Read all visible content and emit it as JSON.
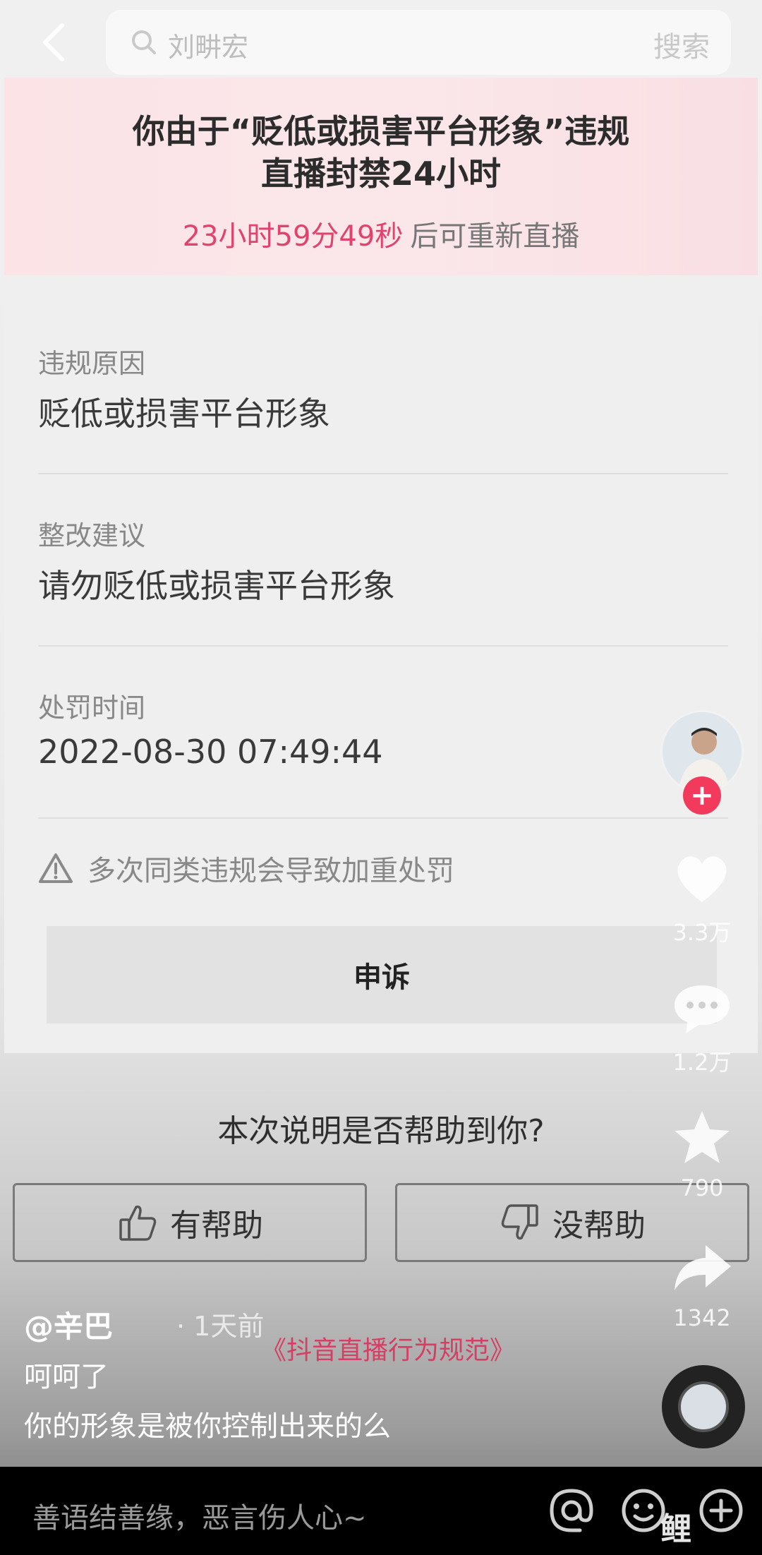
{
  "search": {
    "query": "刘畊宏",
    "button_label": "搜索"
  },
  "banner": {
    "line1": "你由于“贬低或损害平台形象”违规",
    "line2": "直播封禁24小时",
    "countdown": "23小时59分49秒",
    "countdown_suffix": "后可重新直播"
  },
  "details": {
    "reason_label": "违规原因",
    "reason_value": "贬低或损害平台形象",
    "advice_label": "整改建议",
    "advice_value": "请勿贬低或损害平台形象",
    "time_label": "处罚时间",
    "time_value": "2022-08-30 07:49:44",
    "warning": "多次同类违规会导致加重处罚",
    "appeal_label": "申诉"
  },
  "feedback": {
    "question": "本次说明是否帮助到你?",
    "helpful_label": "有帮助",
    "unhelpful_label": "没帮助"
  },
  "side": {
    "likes": "3.3万",
    "comments": "1.2万",
    "favorites": "790",
    "shares": "1342"
  },
  "caption": {
    "author": "@辛巴",
    "time_ago": "· 1天前",
    "rule_link": "《抖音直播行为规范》",
    "line1": "呵呵了",
    "line2": "你的形象是被你控制出来的么"
  },
  "comment_bar": {
    "placeholder": "善语结善缘，恶言伤人心~"
  },
  "watermark": {
    "text": "鲤"
  },
  "colors": {
    "accent_pink": "#e0436b",
    "follow_red": "#f23b5c",
    "banner_bg": "#fbe3e6"
  }
}
